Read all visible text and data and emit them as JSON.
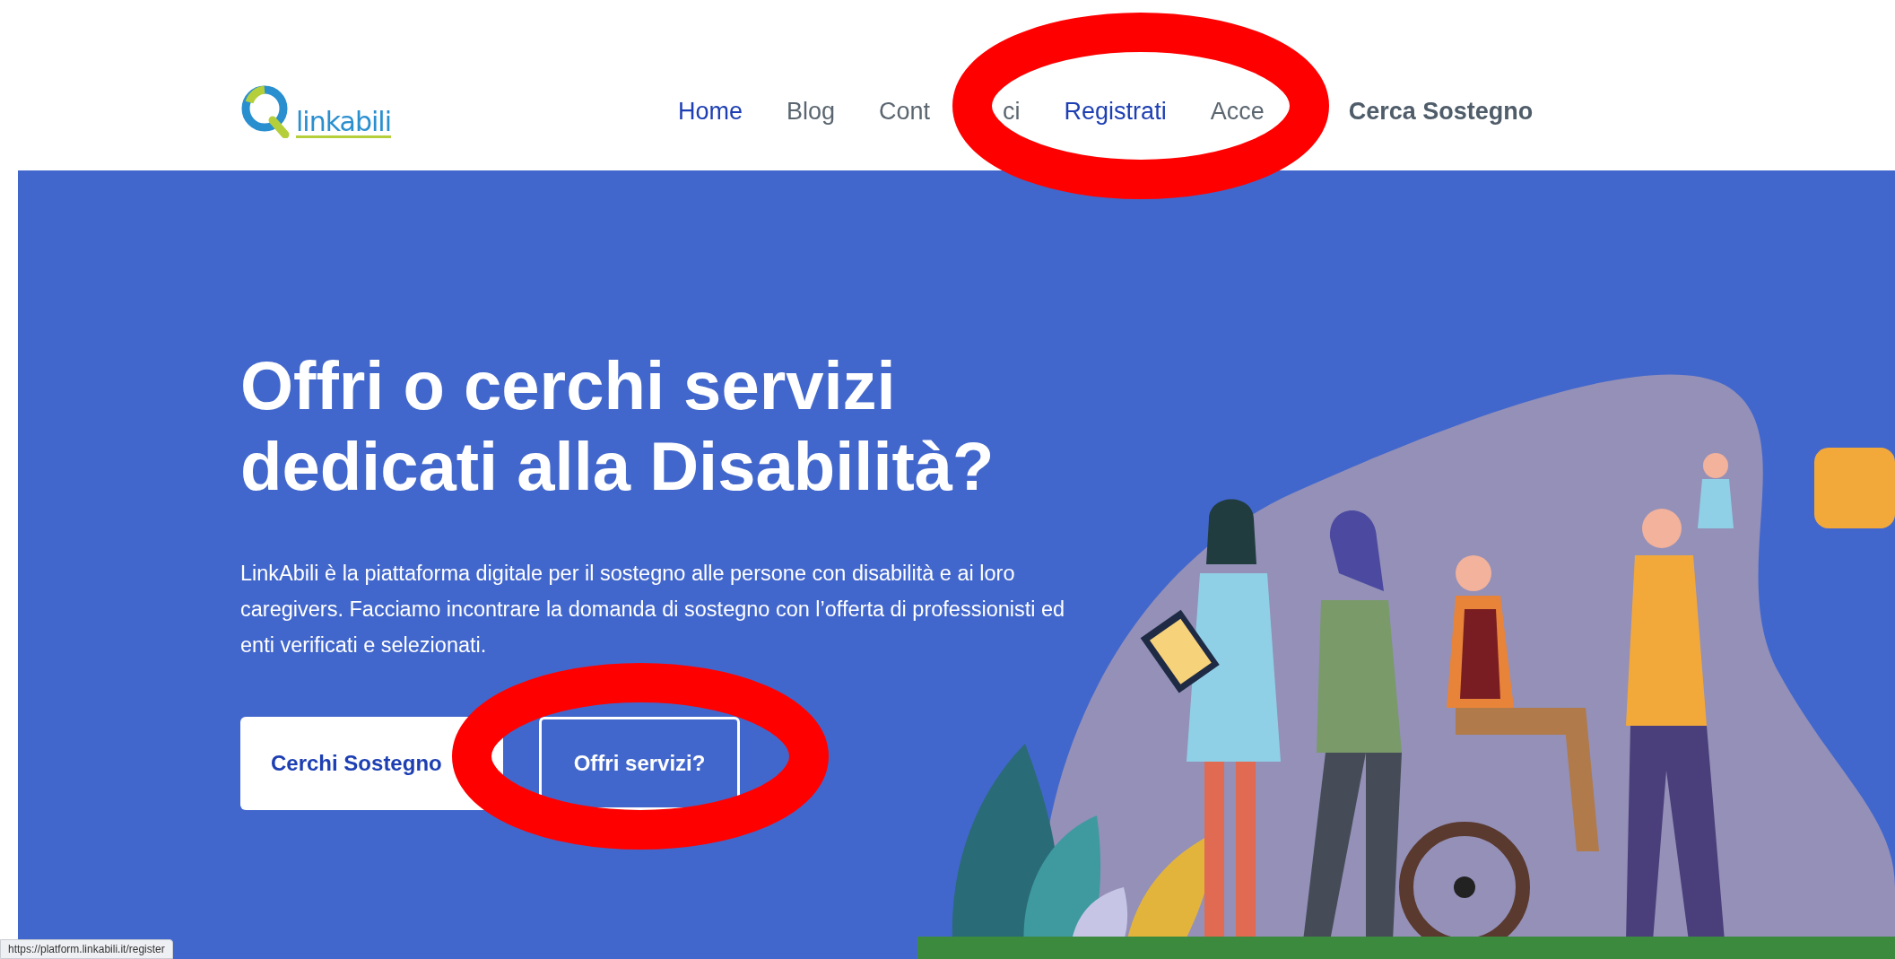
{
  "header": {
    "logo_text": "linkabili",
    "nav": [
      {
        "label": "Home",
        "highlighted": true,
        "kind": "link"
      },
      {
        "label": "Blog",
        "highlighted": false,
        "kind": "link"
      },
      {
        "label": "Cont",
        "tail": "ci",
        "highlighted": false,
        "kind": "link"
      },
      {
        "label": "Registrati",
        "highlighted": true,
        "kind": "link"
      },
      {
        "label": "Acce",
        "highlighted": false,
        "kind": "link"
      },
      {
        "label": "Cerca Sostegno",
        "highlighted": false,
        "kind": "cta"
      }
    ]
  },
  "hero": {
    "heading": "Offri o cerchi servizi dedicati alla Disabilità?",
    "text": "LinkAbili è la piattaforma digitale per il sostegno alle persone con disabilità e ai loro caregivers. Facciamo incontrare la domanda di sostegno con l’offerta di professionisti ed enti verificati e selezionati.",
    "buttons": [
      {
        "label": "Cerchi Sostegno",
        "kind": "solid"
      },
      {
        "label": "Offri servizi?",
        "kind": "outline"
      }
    ]
  },
  "status_bar": "https://platform.linkabili.it/register",
  "annotation_marks": [
    {
      "kind": "oval"
    },
    {
      "kind": "oval"
    }
  ]
}
